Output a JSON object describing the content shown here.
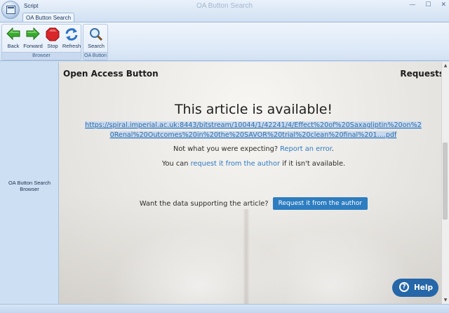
{
  "window": {
    "title": "OA Button Search",
    "script_tab": "Script",
    "minimize": "—",
    "maximize": "☐",
    "close": "✕"
  },
  "ribbon": {
    "tab": "OA Button Search",
    "groups": [
      {
        "label": "Browser",
        "buttons": [
          {
            "label": "Back",
            "icon": "arrow-left-icon"
          },
          {
            "label": "Forward",
            "icon": "arrow-right-icon"
          },
          {
            "label": "Stop",
            "icon": "stop-icon"
          },
          {
            "label": "Refresh",
            "icon": "refresh-icon"
          }
        ]
      },
      {
        "label": "OA Button",
        "buttons": [
          {
            "label": "Search",
            "icon": "magnifier-icon"
          }
        ]
      }
    ]
  },
  "left_panel": {
    "label": "OA Button Search Browser"
  },
  "page": {
    "brand": "Open Access Button",
    "nav_requests": "Requests",
    "headline": "This article is available!",
    "article_url": "https://spiral.imperial.ac.uk:8443/bitstream/10044/1/42241/4/Effect%20of%20Saxagliptin%20on%20Renal%20Outcomes%20in%20the%20SAVOR%20trial%20clean%20final%201....pdf",
    "expect_prefix": "Not what you were expecting?",
    "report_link": "Report an error",
    "expect_suffix": ".",
    "request_prefix": "You can",
    "request_link": "request it from the author",
    "request_suffix": "if it isn't available.",
    "data_prompt": "Want the data supporting the article?",
    "data_button": "Request it from the author",
    "help_button": "Help",
    "help_glyph": "?"
  },
  "colors": {
    "accent": "#2d7dc0",
    "link": "#2f7bc1",
    "help": "#2567a8"
  }
}
